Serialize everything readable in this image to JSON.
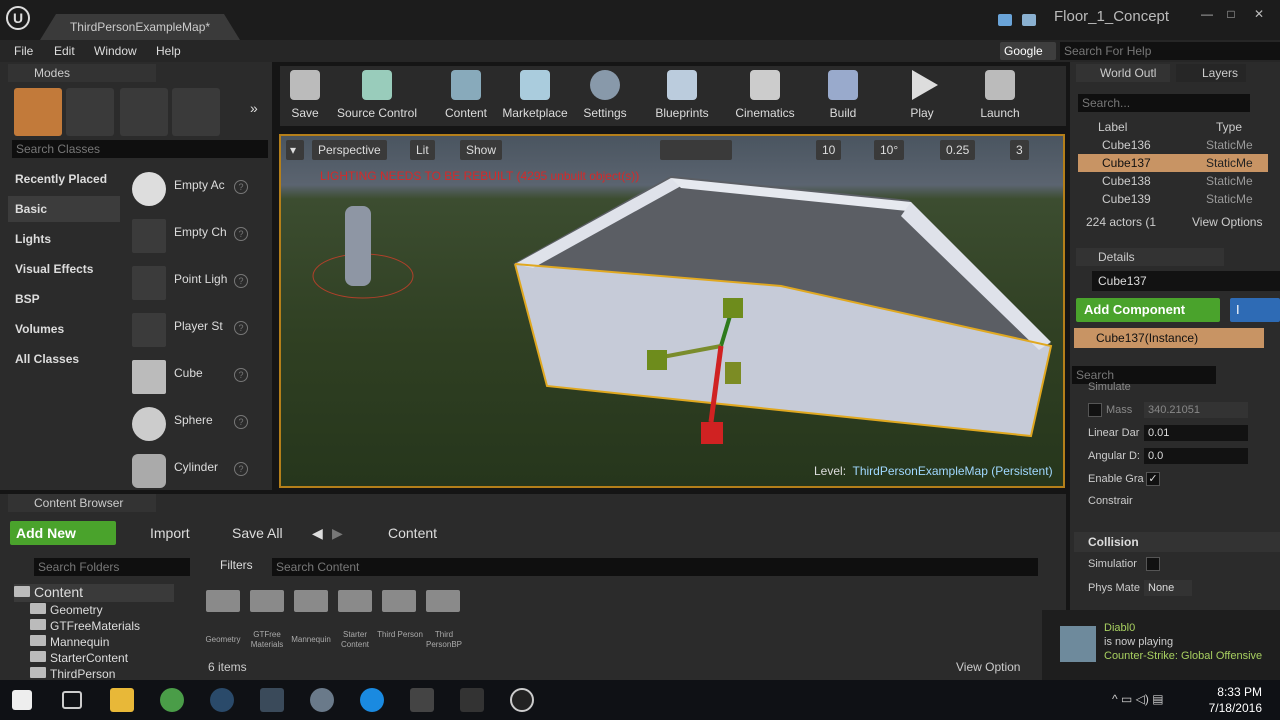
{
  "window": {
    "tab_title": "ThirdPersonExampleMap*",
    "project_title": "Floor_1_Concept",
    "min": "—",
    "max": "□",
    "close": "✕"
  },
  "menu": [
    "File",
    "Edit",
    "Window",
    "Help"
  ],
  "help": {
    "engine": "Google",
    "placeholder": "Search For Help"
  },
  "modes": {
    "tab": "Modes",
    "search_placeholder": "Search Classes",
    "categories": [
      "Recently Placed",
      "Basic",
      "Lights",
      "Visual Effects",
      "BSP",
      "Volumes",
      "All Classes"
    ],
    "selected_category": "Basic",
    "items": [
      "Empty Ac",
      "Empty Ch",
      "Point Ligh",
      "Player St",
      "Cube",
      "Sphere",
      "Cylinder"
    ]
  },
  "toolbar": [
    "Save",
    "Source Control",
    "Content",
    "Marketplace",
    "Settings",
    "Blueprints",
    "Cinematics",
    "Build",
    "Play",
    "Launch"
  ],
  "viewport": {
    "perspective": "Perspective",
    "lit": "Lit",
    "show": "Show",
    "grid": "10",
    "angle": "10°",
    "scale": "0.25",
    "cam_speed": "3",
    "warning": "LIGHTING NEEDS TO BE REBUILT (4295 unbuilt object(s))",
    "level_label": "Level:",
    "level_name": "ThirdPersonExampleMap (Persistent)"
  },
  "outliner": {
    "tab": "World Outl",
    "tab2": "Layers",
    "search": "Search...",
    "col_label": "Label",
    "col_type": "Type",
    "rows": [
      {
        "name": "Cube136",
        "type": "StaticMe"
      },
      {
        "name": "Cube137",
        "type": "StaticMe"
      },
      {
        "name": "Cube138",
        "type": "StaticMe"
      },
      {
        "name": "Cube139",
        "type": "StaticMe"
      }
    ],
    "actor_count": "224 actors (1",
    "view_options": "View Options"
  },
  "details": {
    "tab": "Details",
    "name": "Cube137",
    "add_component": "Add Component",
    "blueprint_btn": "I",
    "instance": "Cube137(Instance)",
    "search": "Search",
    "props": {
      "simulate": "Simulate",
      "mass": "Mass",
      "mass_val": "340.21051",
      "linear": "Linear Dar",
      "linear_val": "0.01",
      "angular": "Angular D:",
      "angular_val": "0.0",
      "gravity": "Enable Gra",
      "constraint": "Constrair"
    },
    "collision": "Collision",
    "simulation": "Simulatior",
    "phys_mat": "Phys Mate",
    "phys_val": "None"
  },
  "content_browser": {
    "tab": "Content Browser",
    "add_new": "Add New",
    "import": "Import",
    "save_all": "Save All",
    "path": "Content",
    "folder_search": "Search Folders",
    "filters": "Filters",
    "content_search": "Search Content",
    "tree": [
      "Content",
      "Geometry",
      "GTFreeMaterials",
      "Mannequin",
      "StarterContent",
      "ThirdPerson"
    ],
    "folders": [
      "Geometry",
      "GTFree Materials",
      "Mannequin",
      "Starter Content",
      "Third Person",
      "Third PersonBP"
    ],
    "items_count": "6 items",
    "view_options": "View Option"
  },
  "notification": {
    "user": "Diabl0",
    "status": "is now playing",
    "game": "Counter-Strike: Global Offensive"
  },
  "taskbar": {
    "time": "8:33 PM",
    "date": "7/18/2016"
  }
}
